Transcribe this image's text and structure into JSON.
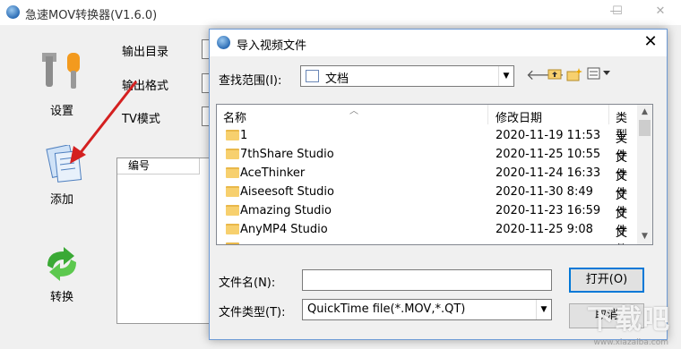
{
  "main": {
    "title": "急速MOV转换器(V1.6.0)",
    "window_buttons": [
      "—",
      "☐",
      "✕"
    ],
    "sidebar": [
      {
        "label": "设置",
        "icon": "wrench-icon"
      },
      {
        "label": "添加",
        "icon": "add-files-icon"
      },
      {
        "label": "转换",
        "icon": "convert-arrows-icon"
      }
    ],
    "fields": [
      {
        "label": "输出目录",
        "value": ""
      },
      {
        "label": "输出格式",
        "value": ""
      },
      {
        "label": "TV模式",
        "value": ""
      }
    ],
    "list_header": "编号"
  },
  "dialog": {
    "title": "导入视频文件",
    "lookin_label": "查找范围(I):",
    "lookin_value": "文档",
    "columns": {
      "name": "名称",
      "date": "修改日期",
      "type": "类型"
    },
    "rows": [
      {
        "name": "1",
        "date": "2020-11-19 11:53",
        "type": "文件"
      },
      {
        "name": "7thShare Studio",
        "date": "2020-11-25 10:55",
        "type": "文件"
      },
      {
        "name": "AceThinker",
        "date": "2020-11-24 16:33",
        "type": "文件"
      },
      {
        "name": "Aiseesoft Studio",
        "date": "2020-11-30 8:49",
        "type": "文件"
      },
      {
        "name": "Amazing Studio",
        "date": "2020-11-23 16:59",
        "type": "文件"
      },
      {
        "name": "AnyMP4 Studio",
        "date": "2020-11-25 9:08",
        "type": "文件"
      }
    ],
    "filename_label": "文件名(N):",
    "filename_value": "",
    "filetype_label": "文件类型(T):",
    "filetype_value": "QuickTime file(*.MOV,*.QT)",
    "open_button": "打开(O)",
    "cancel_button": "取消"
  },
  "watermark": {
    "text": "下载吧",
    "url": "www.xiazaiba.com"
  }
}
